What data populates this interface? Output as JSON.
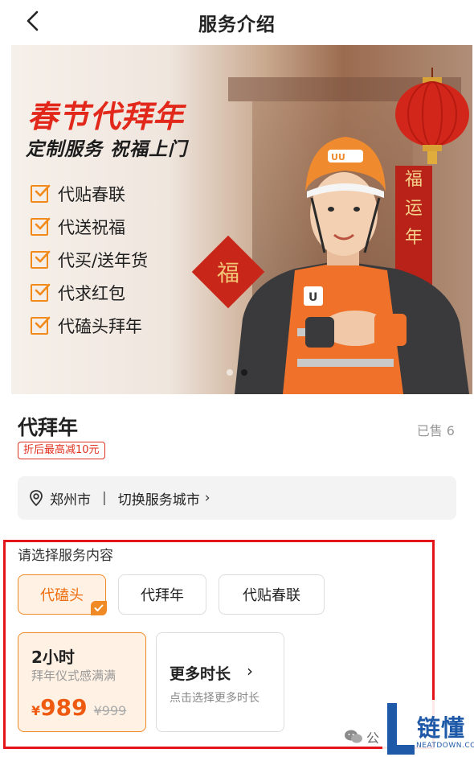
{
  "header": {
    "title": "服务介绍"
  },
  "banner": {
    "title": "春节代拜年",
    "subtitle": "定制服务 祝福上门",
    "features": [
      "代贴春联",
      "代送祝福",
      "代买/送年货",
      "代求红包",
      "代磕头拜年"
    ],
    "fu_char": "福",
    "couplet": [
      "福",
      "运",
      "年"
    ],
    "helmet_logo": "UU跑腿",
    "dots": {
      "total": 2,
      "active": 2
    }
  },
  "product": {
    "title": "代拜年",
    "sold": "已售 6",
    "discount_badge": "折后最高减10元"
  },
  "city_bar": {
    "city": "郑州市",
    "separator": "|",
    "switch_label": "切换服务城市",
    "chevron": "›"
  },
  "service_section": {
    "label": "请选择服务内容",
    "options": [
      {
        "label": "代磕头",
        "selected": true
      },
      {
        "label": "代拜年",
        "selected": false
      },
      {
        "label": "代贴春联",
        "selected": false
      }
    ]
  },
  "duration": {
    "title": "2小时",
    "desc": "拜年仪式感满满",
    "price_symbol": "¥",
    "price": "989",
    "original_price": "¥999"
  },
  "more_duration": {
    "title": "更多时长",
    "chevron": "›",
    "desc": "点击选择更多时长"
  },
  "watermark": {
    "wechat_text": "公",
    "brand_cn": "链懂",
    "brand_en": "NEATDOWN.COM"
  },
  "colors": {
    "accent_orange": "#f08a24",
    "price_orange": "#ee5a10",
    "badge_red": "#e0301e",
    "highlight_red": "#e3151a",
    "brand_blue": "#1f5aa8"
  },
  "icons": {
    "back": "chevron-left-icon",
    "location": "location-pin-icon",
    "check": "checkbox-checked-icon",
    "wechat": "wechat-icon"
  }
}
